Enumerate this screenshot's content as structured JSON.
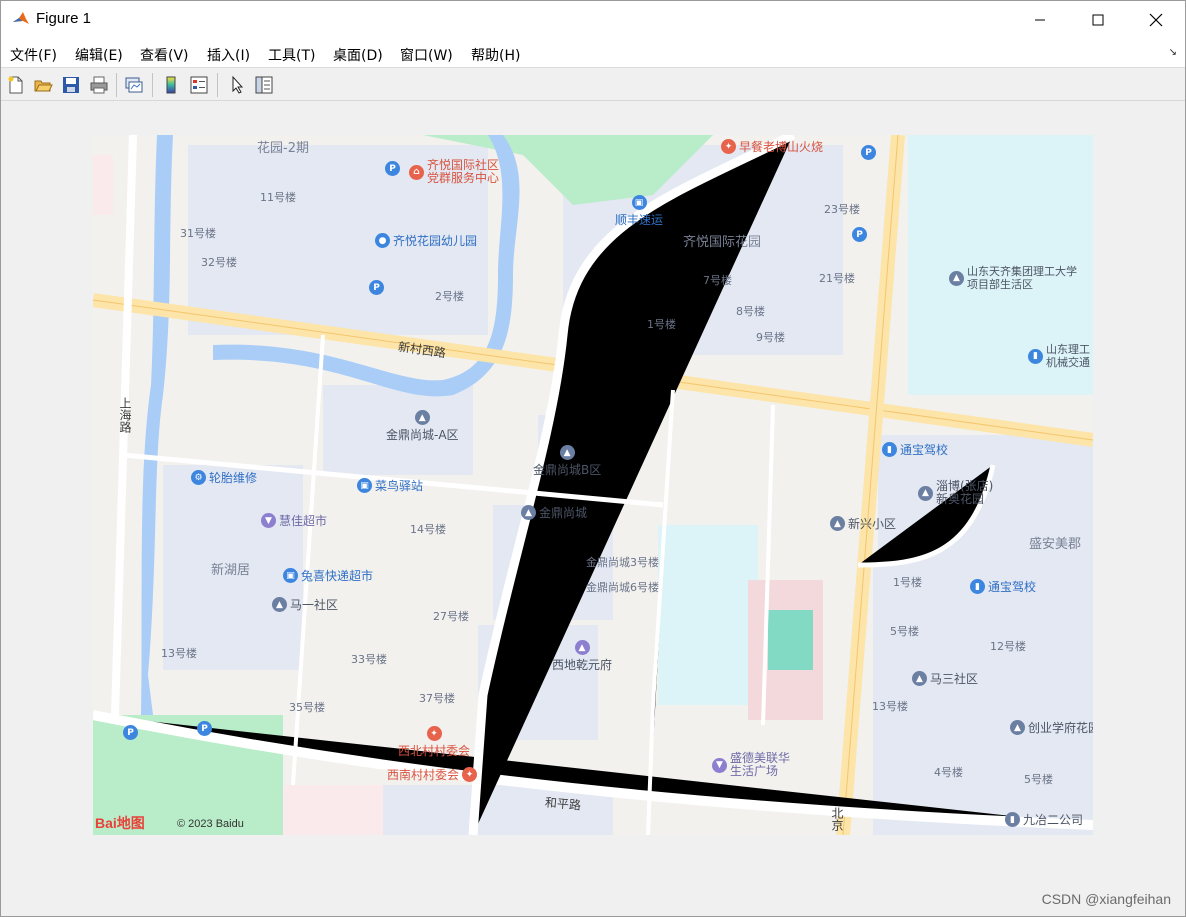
{
  "window": {
    "title": "Figure 1",
    "minimize_glyph": "—",
    "maximize_glyph": "☐",
    "close_glyph": "✕"
  },
  "menu": {
    "items": [
      "文件(F)",
      "编辑(E)",
      "查看(V)",
      "插入(I)",
      "工具(T)",
      "桌面(D)",
      "窗口(W)",
      "帮助(H)"
    ],
    "arrow": "↘"
  },
  "toolbar": {
    "icons": [
      "new-figure-icon",
      "open-file-icon",
      "save-icon",
      "print-icon",
      "link-plot-icon",
      "colorbar-icon",
      "legend-icon",
      "pointer-icon",
      "plot-tools-icon"
    ]
  },
  "map": {
    "roads": {
      "xincun_west": "新村西路",
      "shanghai": "上海路",
      "heping": "和平路",
      "beijing": "北京"
    },
    "areas": {
      "huayuan_2": "花园-2期",
      "qiyue_garden": "齐悦国际花园",
      "xinhuju": "新湖居",
      "shengan": "盛安美郡"
    },
    "buildings": {
      "b11": "11号楼",
      "b31": "31号楼",
      "b32": "32号楼",
      "b2": "2号楼",
      "b23": "23号楼",
      "b7": "7号楼",
      "b21": "21号楼",
      "b8": "8号楼",
      "b1": "1号楼",
      "b9": "9号楼",
      "b14": "14号楼",
      "b27": "27号楼",
      "b33": "33号楼",
      "b37": "37号楼",
      "b35": "35号楼",
      "b13": "13号楼",
      "jd3": "金鼎尚城3号楼",
      "jd6": "金鼎尚城6号楼",
      "r1": "1号楼",
      "r5": "5号楼",
      "r12": "12号楼",
      "r13": "13号楼",
      "r4": "4号楼",
      "r5b": "5号楼"
    },
    "pois": {
      "qiyue_party": "齐悦国际社区\n党群服务中心",
      "qiyue_kinder": "齐悦花园幼儿园",
      "breakfast": "早餐老博山火烧",
      "sf": "顺丰速运",
      "sdut_ganbu": "山东天齐集团理工大学\n项目部生活区",
      "sdut_mech": "山东理工\n机械交通",
      "jinding_a": "金鼎尚城-A区",
      "jinding_b": "金鼎尚城B区",
      "jinding": "金鼎尚城",
      "tire": "轮胎维修",
      "cainiao": "菜鸟驿站",
      "huijia": "慧佳超市",
      "tuxi": "兔喜快递超市",
      "ma1": "马一社区",
      "xidi": "西地乾元府",
      "tongbao1": "通宝驾校",
      "zibo": "淄博(张店)\n新奥花园",
      "xinxing": "新兴小区",
      "tongbao2": "通宝驾校",
      "ma3": "马三社区",
      "chuangye": "创业学府花园",
      "jiuye": "九冶二公司",
      "xibei": "西北村村委会",
      "xinan": "西南村村委会",
      "shengde": "盛德美联华\n生活广场"
    },
    "copyright": "© 2023 Baidu",
    "logo": "Bai地图"
  },
  "watermark": "CSDN @xiangfeihan"
}
